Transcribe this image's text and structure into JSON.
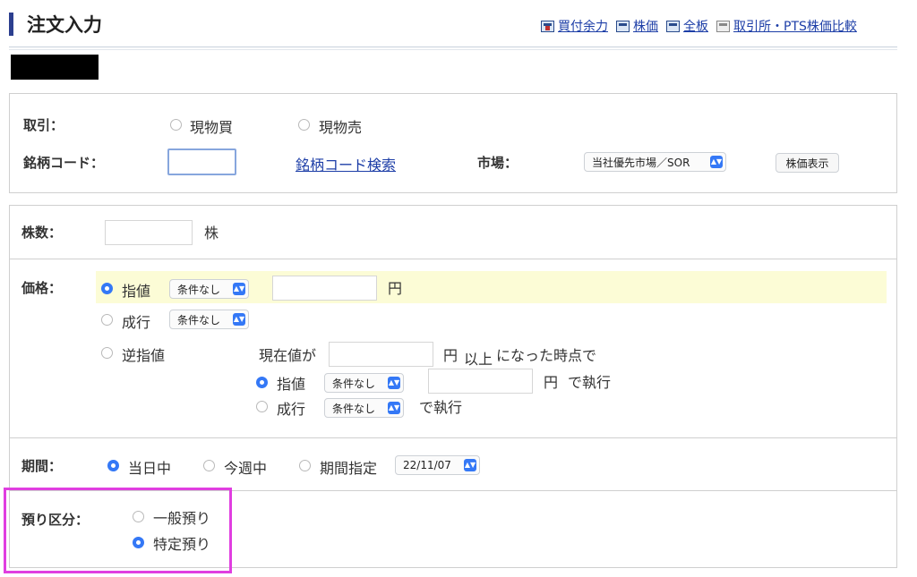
{
  "header": {
    "title": "注文入力",
    "links": [
      "買付余力",
      "株価",
      "全板",
      "取引所・PTS株価比較"
    ]
  },
  "trade": {
    "label": "取引：",
    "options": [
      "現物買",
      "現物売"
    ]
  },
  "symbol": {
    "label": "銘柄コード：",
    "code_value": "",
    "search_link": "銘柄コード検索",
    "market_label": "市場：",
    "market_value": "当社優先市場／SOR",
    "price_button": "株価表示"
  },
  "quantity": {
    "label": "株数：",
    "value": "",
    "unit": "株"
  },
  "price": {
    "label": "価格：",
    "limit_label": "指値",
    "limit_condition": "条件なし",
    "limit_value": "",
    "yen": "円",
    "market_label": "成行",
    "market_condition": "条件なし",
    "stop_label": "逆指値",
    "stop_current": "現在値が",
    "stop_yen": "円",
    "stop_above": "以上",
    "stop_trigger": "になった時点で",
    "stop_limit_label": "指値",
    "stop_limit_condition": "条件なし",
    "stop_limit_yen": "円",
    "stop_exec": "で執行",
    "stop_market_label": "成行",
    "stop_market_condition": "条件なし",
    "stop_market_exec": "で執行"
  },
  "period": {
    "label": "期間：",
    "options": [
      "当日中",
      "今週中",
      "期間指定"
    ],
    "date_value": "22/11/07"
  },
  "custody": {
    "label": "預り区分：",
    "options": [
      "一般預り",
      "特定預り"
    ]
  },
  "colors": {
    "accent": "#3478f6",
    "link": "#1d3ea7",
    "highlight": "#e03ee0",
    "limit_row_bg": "#fcfcd6"
  }
}
